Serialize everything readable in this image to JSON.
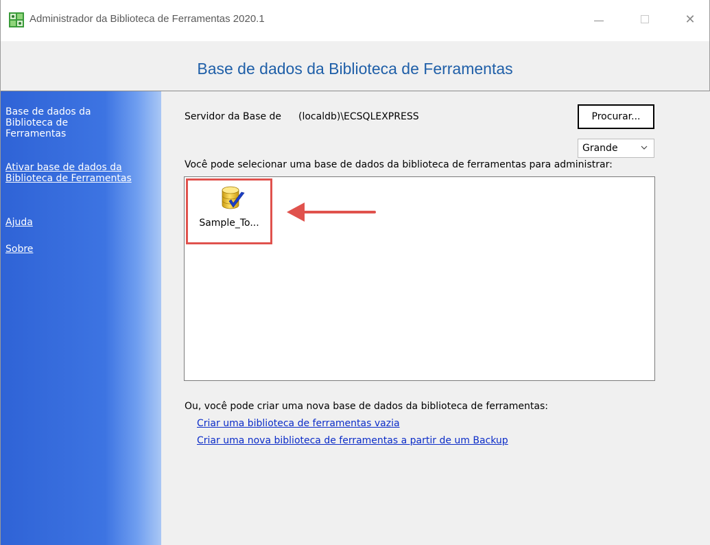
{
  "window": {
    "title": "Administrador da Biblioteca de Ferramentas 2020.1",
    "minimize_glyph": "",
    "maximize_glyph": "",
    "close_glyph": "✕"
  },
  "header": {
    "title": "Base de dados da Biblioteca de Ferramentas"
  },
  "sidebar": {
    "active_item": "Base de dados da Biblioteca de Ferramentas",
    "items": [
      {
        "label": "Ativar base de dados da Biblioteca de Ferramentas"
      },
      {
        "label": "Ajuda"
      },
      {
        "label": "Sobre"
      }
    ]
  },
  "main": {
    "server_label": "Servidor da Base de",
    "server_value": "(localdb)\\ECSQLEXPRESS",
    "browse_label": "Procurar...",
    "view_size": "Grande",
    "choose_label": "Você pode selecionar uma base de dados da biblioteca de ferramentas para administrar:",
    "databases": [
      {
        "name": "Sample_To...",
        "icon": "database-check-icon"
      }
    ],
    "create_label": "Ou, você pode criar uma nova base de dados da biblioteca de ferramentas:",
    "links": {
      "create_empty": "Criar uma biblioteca de ferramentas vazia",
      "create_from_backup": "Criar uma nova biblioteca de ferramentas a partir de um Backup"
    }
  },
  "colors": {
    "title_blue": "#1f5fa8",
    "sidebar_blue": "#3d74e2",
    "link_blue": "#0b2cc8",
    "annotation_red": "#e0524d"
  }
}
